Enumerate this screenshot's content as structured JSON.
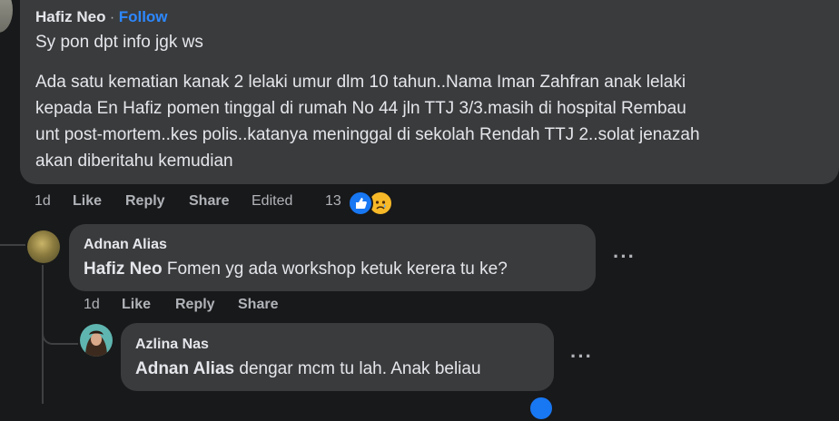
{
  "comment": {
    "author": "Hafiz Neo",
    "separator": "·",
    "follow": "Follow",
    "line1": "Sy pon dpt info jgk ws",
    "para": [
      "Ada satu kematian kanak 2 lelaki umur dlm 10 tahun..Nama Iman Zahfran anak lelaki",
      "kepada En Hafiz pomen tinggal di rumah No 44 jln TTJ 3/3.masih di hospital Rembau",
      "unt post-mortem..kes polis..katanya meninggal di sekolah Rendah TTJ 2..solat jenazah",
      "akan diberitahu kemudian"
    ],
    "time": "1d",
    "like": "Like",
    "reply": "Reply",
    "share": "Share",
    "edited": "Edited",
    "reactions": "13"
  },
  "reply1": {
    "author": "Adnan Alias",
    "mention": "Hafiz Neo",
    "text": " Fomen yg ada workshop ketuk kerera tu ke?",
    "time": "1d",
    "like": "Like",
    "reply": "Reply",
    "share": "Share",
    "more": "···"
  },
  "reply2": {
    "author": "Azlina Nas",
    "mention": "Adnan Alias",
    "text": " dengar mcm tu lah. Anak beliau",
    "more": "···"
  },
  "colors": {
    "accent": "#2d88ff",
    "bubble": "#3a3b3c",
    "bg": "#18191a",
    "like_blue": "#1877f2",
    "sad_yellow": "#f7b928"
  }
}
